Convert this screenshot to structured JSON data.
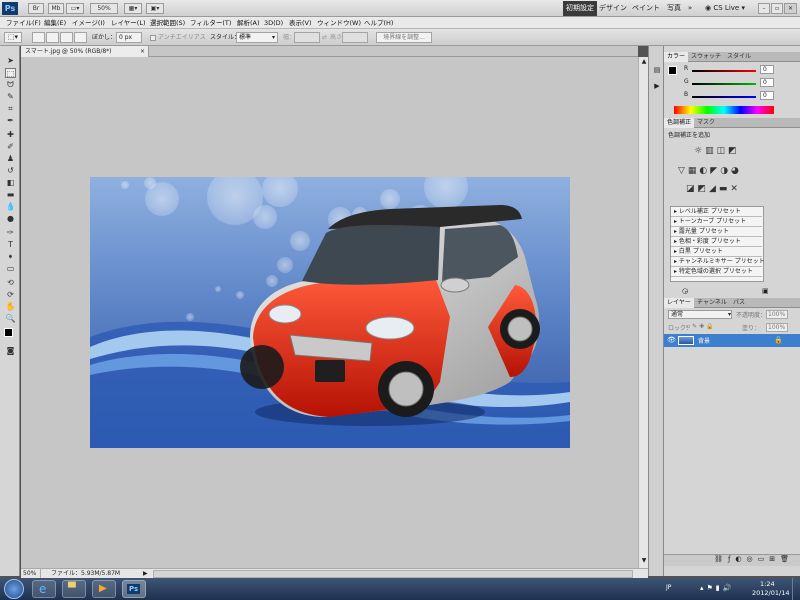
{
  "app": {
    "logo": "Ps",
    "zoom": "50%"
  },
  "workspaces": {
    "essentials": "初期設定",
    "design": "デザイン",
    "paint": "ペイント",
    "photo": "写真",
    "more": "»",
    "cslive": "CS Live"
  },
  "menu": [
    "ファイル(F)",
    "編集(E)",
    "イメージ(I)",
    "レイヤー(L)",
    "選択範囲(S)",
    "フィルター(T)",
    "解析(A)",
    "3D(D)",
    "表示(V)",
    "ウィンドウ(W)",
    "ヘルプ(H)"
  ],
  "options": {
    "feather_label": "ぼかし：",
    "feather_value": "0 px",
    "antialias": "アンチエイリアス",
    "style_label": "スタイル：",
    "style_value": "標準",
    "width_label": "幅：",
    "height_label": "高さ：",
    "refine": "境界線を調整..."
  },
  "document": {
    "tab": "スマート.jpg @ 50% (RGB/8*)",
    "close": "×",
    "status_zoom": "50%",
    "status_file": "ファイル：5.93M/5.87M"
  },
  "color_panel": {
    "tabs": [
      "カラー",
      "スウォッチ",
      "スタイル"
    ],
    "r_label": "R",
    "g_label": "G",
    "b_label": "B",
    "r": "0",
    "g": "0",
    "b": "0"
  },
  "adjust_panel": {
    "tabs": [
      "色調補正",
      "マスク"
    ],
    "heading": "色調補正を追加",
    "presets": [
      "レベル補正 プリセット",
      "トーンカーブ プリセット",
      "露光量 プリセット",
      "色相・彩度 プリセット",
      "白黒 プリセット",
      "チャンネルミキサー プリセット",
      "特定色域の選択 プリセット"
    ]
  },
  "layers_panel": {
    "tabs": [
      "レイヤー",
      "チャンネル",
      "パス"
    ],
    "blend": "通常",
    "opacity_label": "不透明度：",
    "opacity": "100%",
    "lock_label": "ロック：",
    "fill_label": "塗り：",
    "fill": "100%",
    "layer_name": "背景"
  },
  "taskbar": {
    "lang": "JP",
    "time": "1:24",
    "date": "2012/01/14"
  },
  "colors": {
    "accent_blue": "#3d7fcf",
    "taskbar": "#22385a",
    "car_red": "#d81e0a"
  }
}
